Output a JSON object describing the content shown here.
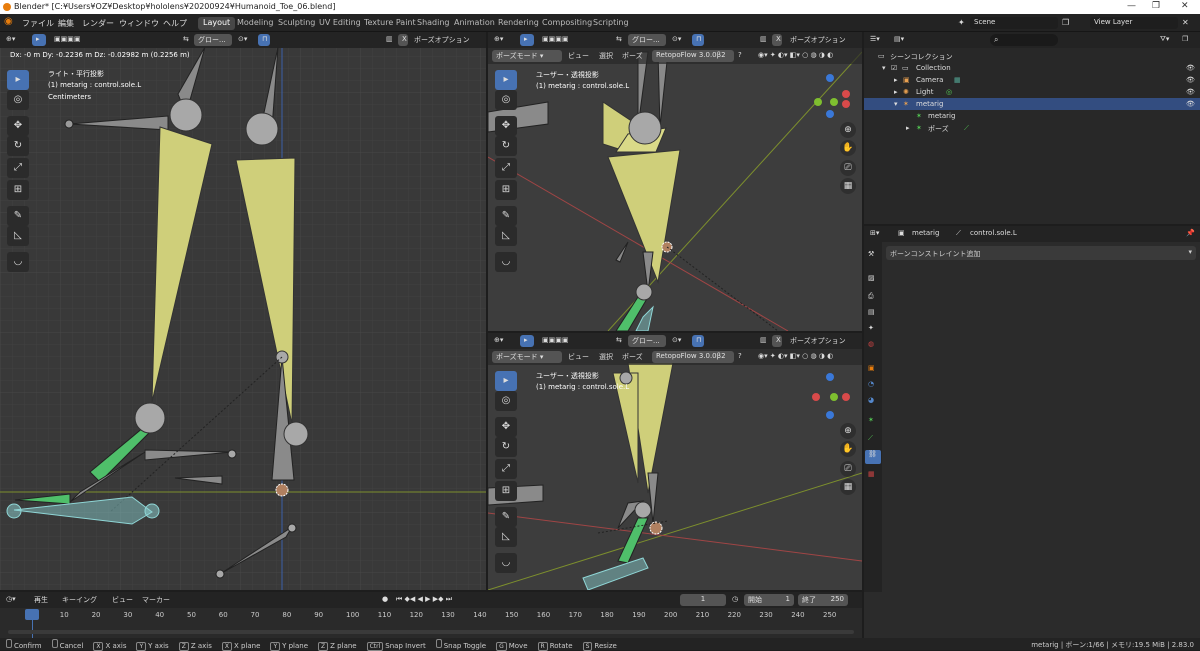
{
  "titlebar": {
    "title": "Blender* [C:¥Users¥OZ¥Desktop¥hololens¥20200924¥Humanoid_Toe_06.blend]",
    "min": "—",
    "max": "❐",
    "close": "✕"
  },
  "menus": [
    "ファイル",
    "編集",
    "レンダー",
    "ウィンドウ",
    "ヘルプ"
  ],
  "workspaces": [
    "Layout",
    "Modeling",
    "Sculpting",
    "UV Editing",
    "Texture Paint",
    "Shading",
    "Animation",
    "Rendering",
    "Compositing",
    "Scripting"
  ],
  "scene": {
    "name": "Scene",
    "view_layer": "View Layer"
  },
  "vp_left": {
    "transform_info": "Dx: -0 m  Dy: -0.2236 m  Dz: -0.02982 m (0.2256 m)",
    "view_name": "ライト・平行投影",
    "object": "(1) metarig : control.sole.L",
    "units": "Centimeters",
    "global": "グロー...",
    "options": "ポーズオプション"
  },
  "vp_right": {
    "mode": "ポーズモード",
    "menus": [
      "ビュー",
      "選択",
      "ポーズ"
    ],
    "retopo": "RetopoFlow 3.0.0β2",
    "global": "グロー...",
    "options": "ポーズオプション"
  },
  "vp_tr": {
    "view_name": "ユーザー・透視投影",
    "object": "(1) metarig : control.sole.L"
  },
  "vp_br": {
    "view_name": "ユーザー・透視投影",
    "object": "(1) metarig : control.sole.L"
  },
  "outliner": {
    "search_placeholder": "",
    "scene_collection": "シーンコレクション",
    "items": [
      {
        "label": "Collection",
        "depth": 1
      },
      {
        "label": "Camera",
        "depth": 2
      },
      {
        "label": "Light",
        "depth": 2
      },
      {
        "label": "metarig",
        "depth": 2
      },
      {
        "label": "metarig",
        "depth": 3
      },
      {
        "label": "ポーズ",
        "depth": 3
      }
    ]
  },
  "properties": {
    "object": "metarig",
    "bone": "control.sole.L",
    "add_constraint": "ボーンコンストレイント追加"
  },
  "timeline": {
    "menus": [
      "再生",
      "キーイング",
      "ビュー",
      "マーカー"
    ],
    "current_frame": "1",
    "start_label": "開始",
    "start": "1",
    "end_label": "終了",
    "end": "250",
    "ticks": [
      "1",
      "10",
      "20",
      "30",
      "40",
      "50",
      "60",
      "70",
      "80",
      "90",
      "100",
      "110",
      "120",
      "130",
      "140",
      "150",
      "160",
      "170",
      "180",
      "190",
      "200",
      "210",
      "220",
      "230",
      "240",
      "250"
    ]
  },
  "status": {
    "items": [
      "Confirm",
      "Cancel",
      "X axis",
      "Y axis",
      "Z axis",
      "X plane",
      "Y plane",
      "Z plane",
      "Snap Invert",
      "Snap Toggle",
      "Move",
      "Rotate",
      "Resize"
    ],
    "keys": [
      "",
      "",
      "X",
      "Y",
      "Z",
      "X",
      "Y",
      "Z",
      "Ctrl",
      "",
      "G",
      "R",
      "S"
    ],
    "right": "metarig | ボーン:1/66 | メモリ:19.5 MiB | 2.83.0"
  },
  "colors": {
    "accent": "#4772b3",
    "bone_yellow": "#cfcf7a",
    "bone_green": "#4fbf6a",
    "bone_cyan": "#8fd6d6",
    "bone_gray": "#8a8a8a"
  }
}
